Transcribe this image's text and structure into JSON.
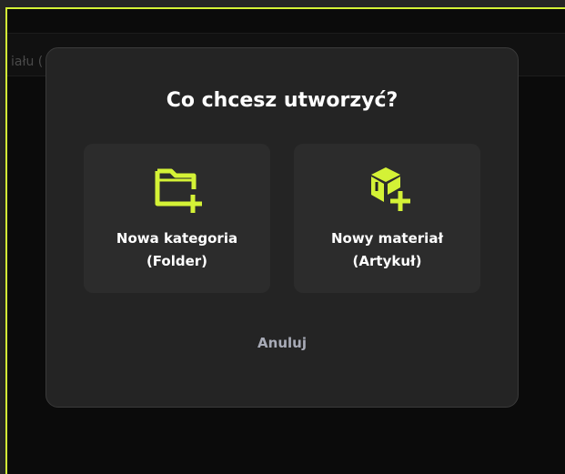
{
  "background": {
    "partial_text": "iału ("
  },
  "dialog": {
    "title": "Co chcesz utworzyć?",
    "options": [
      {
        "icon": "folder-plus-icon",
        "line1": "Nowa kategoria",
        "line2": "(Folder)"
      },
      {
        "icon": "box-plus-icon",
        "line1": "Nowy materiał",
        "line2": "(Artykuł)"
      }
    ],
    "cancel_label": "Anuluj"
  },
  "colors": {
    "accent": "#d4f236",
    "modal_bg": "#242424",
    "card_bg": "#2c2c2c",
    "muted_text": "#a8abb7"
  }
}
